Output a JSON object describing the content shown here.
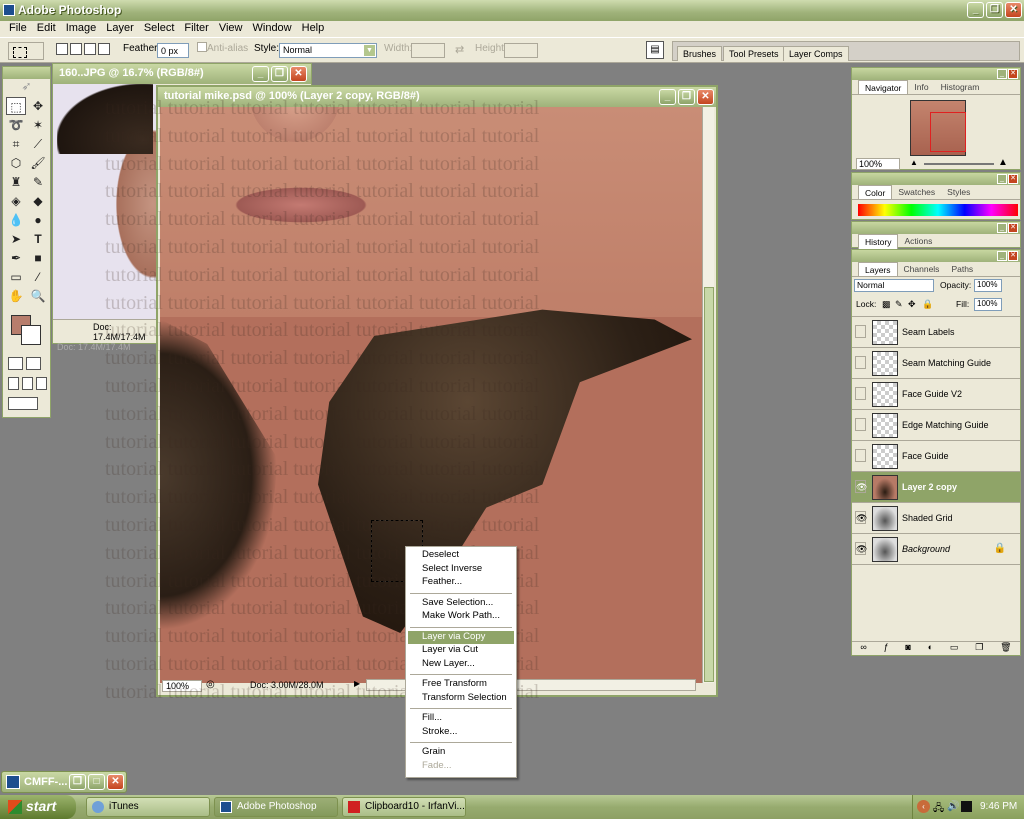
{
  "app": {
    "title": "Adobe Photoshop"
  },
  "menu": [
    "File",
    "Edit",
    "Image",
    "Layer",
    "Select",
    "Filter",
    "View",
    "Window",
    "Help"
  ],
  "options": {
    "feather_label": "Feather:",
    "feather_value": "0 px",
    "anti_alias_label": "Anti-alias",
    "style_label": "Style:",
    "style_value": "Normal",
    "width_label": "Width:",
    "height_label": "Height:"
  },
  "palette_well": {
    "tabs": [
      "Brushes",
      "Tool Presets",
      "Layer Comps"
    ]
  },
  "doc1": {
    "title": "160..JPG @ 16.7% (RGB/8#)",
    "status": "Doc: 17.4M/17.4M",
    "status_hidden": "Doc: 17.4M/17.4M"
  },
  "doc2": {
    "title": "tutorial mike.psd @ 100% (Layer 2 copy, RGB/8#)",
    "zoom": "100%",
    "status": "Doc: 3.00M/28.0M"
  },
  "watermark_word": "tutorial",
  "context_menu": [
    {
      "label": "Deselect"
    },
    {
      "label": "Select Inverse"
    },
    {
      "label": "Feather..."
    },
    {
      "sep": true
    },
    {
      "label": "Save Selection..."
    },
    {
      "label": "Make Work Path..."
    },
    {
      "sep": true
    },
    {
      "label": "Layer via Copy",
      "highlighted": true
    },
    {
      "label": "Layer via Cut"
    },
    {
      "label": "New Layer..."
    },
    {
      "sep": true
    },
    {
      "label": "Free Transform"
    },
    {
      "label": "Transform Selection"
    },
    {
      "sep": true
    },
    {
      "label": "Fill..."
    },
    {
      "label": "Stroke..."
    },
    {
      "sep": true
    },
    {
      "label": "Grain"
    },
    {
      "label": "Fade...",
      "disabled": true
    }
  ],
  "navigator": {
    "tabs": [
      "Navigator",
      "Info",
      "Histogram"
    ],
    "zoom": "100%"
  },
  "color_panel": {
    "tabs": [
      "Color",
      "Swatches",
      "Styles"
    ]
  },
  "history_panel": {
    "tabs": [
      "History",
      "Actions"
    ]
  },
  "layers_panel": {
    "tabs": [
      "Layers",
      "Channels",
      "Paths"
    ],
    "blend_mode": "Normal",
    "opacity_label": "Opacity:",
    "opacity_value": "100%",
    "lock_label": "Lock:",
    "fill_label": "Fill:",
    "fill_value": "100%",
    "layers": [
      {
        "name": "Seam Labels",
        "visible": false,
        "thumb": "checker"
      },
      {
        "name": "Seam Matching Guide",
        "visible": false,
        "thumb": "checker"
      },
      {
        "name": "Face Guide V2",
        "visible": false,
        "thumb": "checker"
      },
      {
        "name": "Edge Matching Guide",
        "visible": false,
        "thumb": "checker"
      },
      {
        "name": "Face Guide",
        "visible": false,
        "thumb": "checker"
      },
      {
        "name": "Layer 2 copy",
        "visible": true,
        "thumb": "face",
        "active": true
      },
      {
        "name": "Shaded Grid",
        "visible": true,
        "thumb": "grid"
      },
      {
        "name": "Background",
        "visible": true,
        "thumb": "grid",
        "locked": true
      }
    ]
  },
  "minimized_window": {
    "title": "CMFF-..."
  },
  "taskbar": {
    "start": "start",
    "tasks": [
      {
        "label": "iTunes",
        "active": false
      },
      {
        "label": "Adobe Photoshop",
        "active": true
      },
      {
        "label": "Clipboard10 - IrfanVi...",
        "active": false
      }
    ],
    "clock": "9:46 PM"
  },
  "colors": {
    "foreground": "#b77d6c",
    "background": "#ffffff",
    "accent": "#8fa468"
  }
}
